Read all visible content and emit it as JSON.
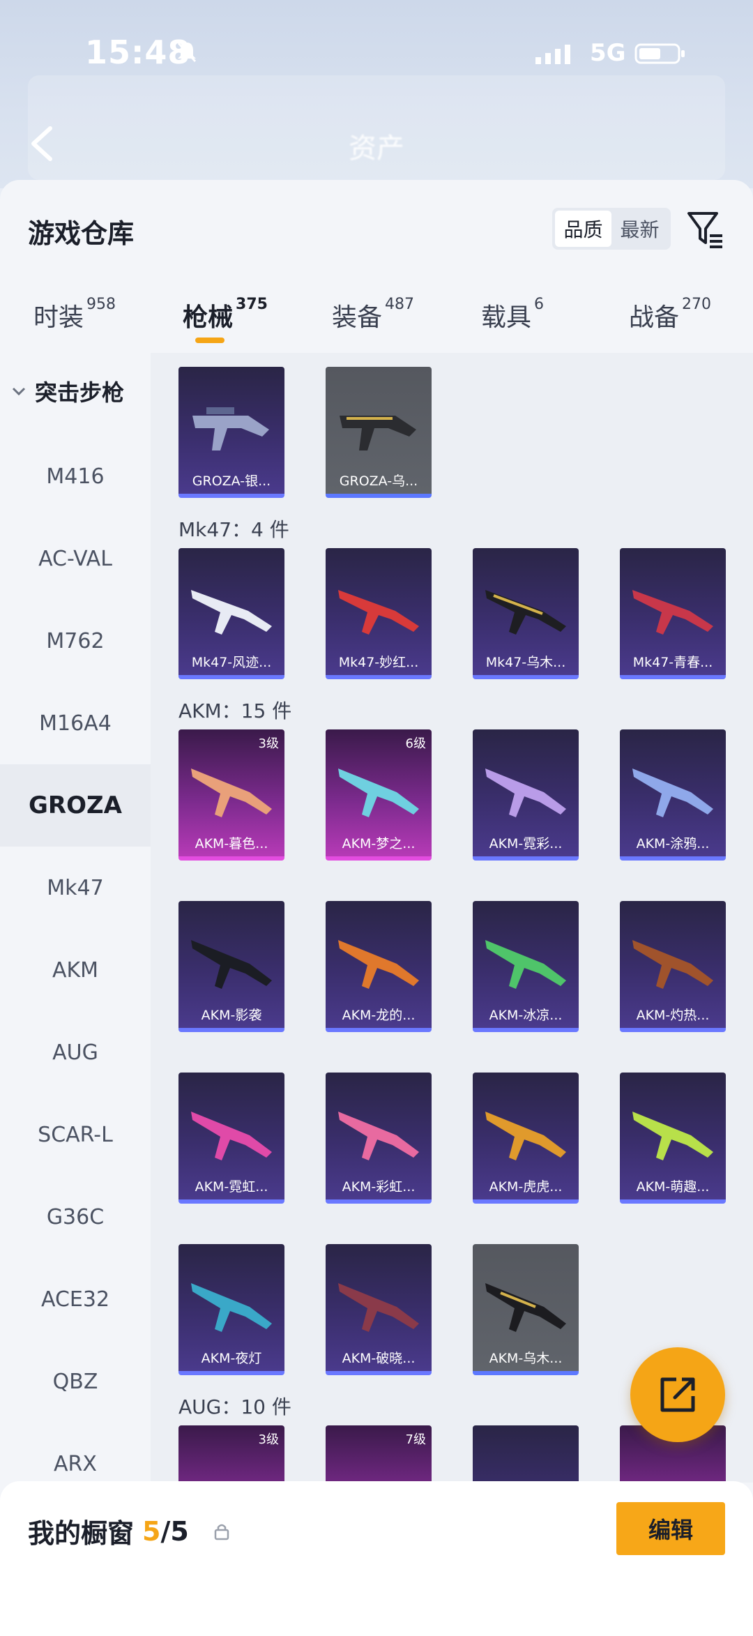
{
  "status_bar": {
    "time": "15:48",
    "network": "5G"
  },
  "header": {
    "title": "资产"
  },
  "sheet": {
    "title": "游戏仓库",
    "sort": {
      "options": [
        "品质",
        "最新"
      ],
      "selected": "品质"
    }
  },
  "tabs": [
    {
      "label": "时装",
      "count": "958"
    },
    {
      "label": "枪械",
      "count": "375"
    },
    {
      "label": "装备",
      "count": "487"
    },
    {
      "label": "载具",
      "count": "6"
    },
    {
      "label": "战备",
      "count": "270"
    }
  ],
  "active_tab": "枪械",
  "sidebar": {
    "category": "突击步枪",
    "items": [
      "M416",
      "AC-VAL",
      "M762",
      "M16A4",
      "GROZA",
      "Mk47",
      "AKM",
      "AUG",
      "SCAR-L",
      "G36C",
      "ACE32",
      "QBZ",
      "ARX"
    ],
    "selected": "GROZA"
  },
  "groups": {
    "groza": {
      "items": [
        "GROZA-银...",
        "GROZA-乌..."
      ]
    },
    "mk47": {
      "label": "Mk47：4 件",
      "items": [
        "Mk47-风迹...",
        "Mk47-妙红...",
        "Mk47-乌木...",
        "Mk47-青春..."
      ]
    },
    "akm": {
      "label": "AKM：15 件",
      "items": [
        "AKM-暮色...",
        "AKM-梦之...",
        "AKM-霓彩...",
        "AKM-涂鸦...",
        "AKM-影袭",
        "AKM-龙的...",
        "AKM-冰凉...",
        "AKM-灼热...",
        "AKM-霓虹...",
        "AKM-彩虹...",
        "AKM-虎虎...",
        "AKM-萌趣...",
        "AKM-夜灯",
        "AKM-破晓...",
        "AKM-乌木..."
      ],
      "levels": [
        "3级",
        "6级"
      ]
    },
    "aug": {
      "label": "AUG：10 件",
      "levels": [
        "3级",
        "7级"
      ]
    }
  },
  "bottom": {
    "showcase_label": "我的橱窗",
    "count_current": "5",
    "count_total": "/5",
    "edit_label": "编辑"
  },
  "colors": {
    "accent": "#f5a516",
    "card_purple": "#3a2e6c",
    "card_pink": "#b63ab6",
    "card_gray": "#60646b"
  }
}
